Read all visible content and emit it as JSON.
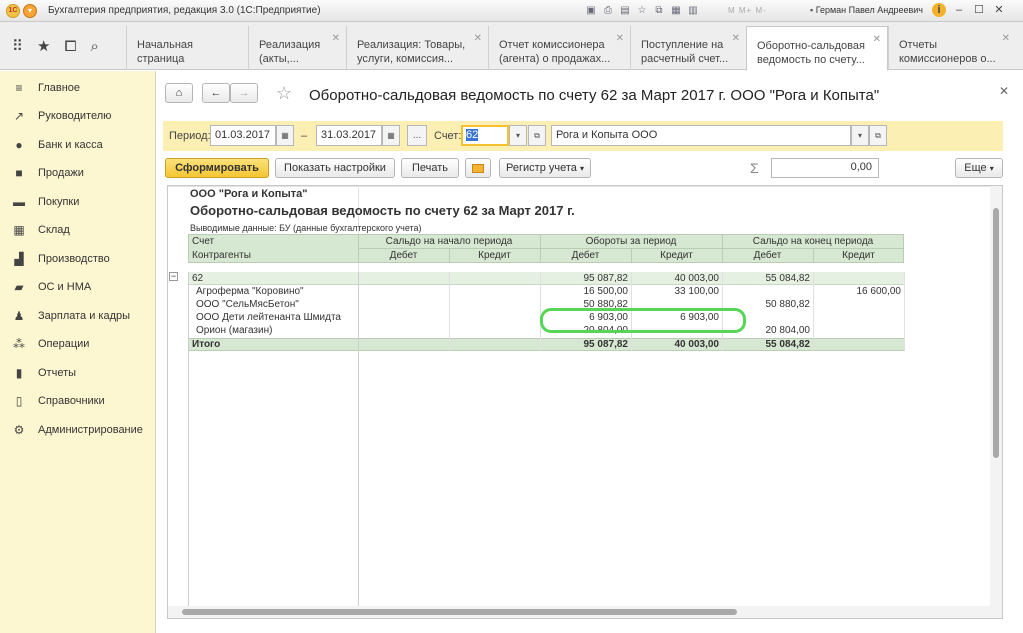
{
  "window": {
    "title": "Бухгалтерия предприятия, редакция 3.0  (1С:Предприятие)",
    "mm": "M  M+  M-",
    "user": "Герман Павел Андреевич"
  },
  "tabs": [
    {
      "label": "Начальная страница"
    },
    {
      "label": "Реализация (акты,..."
    },
    {
      "label": "Реализация: Товары, услуги, комиссия..."
    },
    {
      "label": "Отчет комиссионера (агента) о продажах..."
    },
    {
      "label": "Поступление на расчетный счет..."
    },
    {
      "label": "Оборотно-сальдовая ведомость по счету..."
    },
    {
      "label": "Отчеты комиссионеров о..."
    }
  ],
  "sidebar": [
    {
      "label": "Главное",
      "icon": "menu-icon"
    },
    {
      "label": "Руководителю",
      "icon": "trend-icon"
    },
    {
      "label": "Банк и касса",
      "icon": "coin-icon"
    },
    {
      "label": "Продажи",
      "icon": "bag-icon"
    },
    {
      "label": "Покупки",
      "icon": "cart-icon"
    },
    {
      "label": "Склад",
      "icon": "grid-icon"
    },
    {
      "label": "Производство",
      "icon": "factory-icon"
    },
    {
      "label": "ОС и НМА",
      "icon": "truck-icon"
    },
    {
      "label": "Зарплата и кадры",
      "icon": "person-icon"
    },
    {
      "label": "Операции",
      "icon": "operations-icon"
    },
    {
      "label": "Отчеты",
      "icon": "chart-icon"
    },
    {
      "label": "Справочники",
      "icon": "book-icon"
    },
    {
      "label": "Администрирование",
      "icon": "gear-icon"
    }
  ],
  "doc": {
    "title": "Оборотно-сальдовая ведомость по счету 62 за Март 2017 г. ООО \"Рога и Копыта\""
  },
  "filter": {
    "period_label": "Период:",
    "date_from": "01.03.2017",
    "dash": "–",
    "date_to": "31.03.2017",
    "dots": "...",
    "account_label": "Счет:",
    "account": "62",
    "org": "Рога и Копыта ООО"
  },
  "toolbar": {
    "generate": "Сформировать",
    "settings": "Показать настройки",
    "print": "Печать",
    "register": "Регистр учета",
    "sum_value": "0,00",
    "more": "Еще"
  },
  "report": {
    "org": "ООО \"Рога и Копыта\"",
    "title": "Оборотно-сальдовая ведомость по счету 62 за Март 2017 г.",
    "output": "Выводимые данные:  БУ (данные бухгалтерского учета)",
    "h_account": "Счет",
    "h_contractors": "Контрагенты",
    "h_open": "Сальдо на начало периода",
    "h_turn": "Обороты за период",
    "h_close": "Сальдо на конец периода",
    "debit": "Дебет",
    "credit": "Кредит",
    "rows": [
      {
        "name": "62",
        "c1": "",
        "c2": "",
        "c3": "95 087,82",
        "c4": "40 003,00",
        "c5": "55 084,82",
        "c6": ""
      },
      {
        "name": "Агроферма \"Коровино\"",
        "c1": "",
        "c2": "",
        "c3": "16 500,00",
        "c4": "33 100,00",
        "c5": "",
        "c6": "16 600,00"
      },
      {
        "name": "ООО \"СельМясБетон\"",
        "c1": "",
        "c2": "",
        "c3": "50 880,82",
        "c4": "",
        "c5": "50 880,82",
        "c6": ""
      },
      {
        "name": "ООО Дети лейтенанта Шмидта",
        "c1": "",
        "c2": "",
        "c3": "6 903,00",
        "c4": "6 903,00",
        "c5": "",
        "c6": ""
      },
      {
        "name": "Орион (магазин)",
        "c1": "",
        "c2": "",
        "c3": "20 804,00",
        "c4": "",
        "c5": "20 804,00",
        "c6": ""
      }
    ],
    "total": {
      "name": "Итого",
      "c1": "",
      "c2": "",
      "c3": "95 087,82",
      "c4": "40 003,00",
      "c5": "55 084,82",
      "c6": ""
    }
  }
}
